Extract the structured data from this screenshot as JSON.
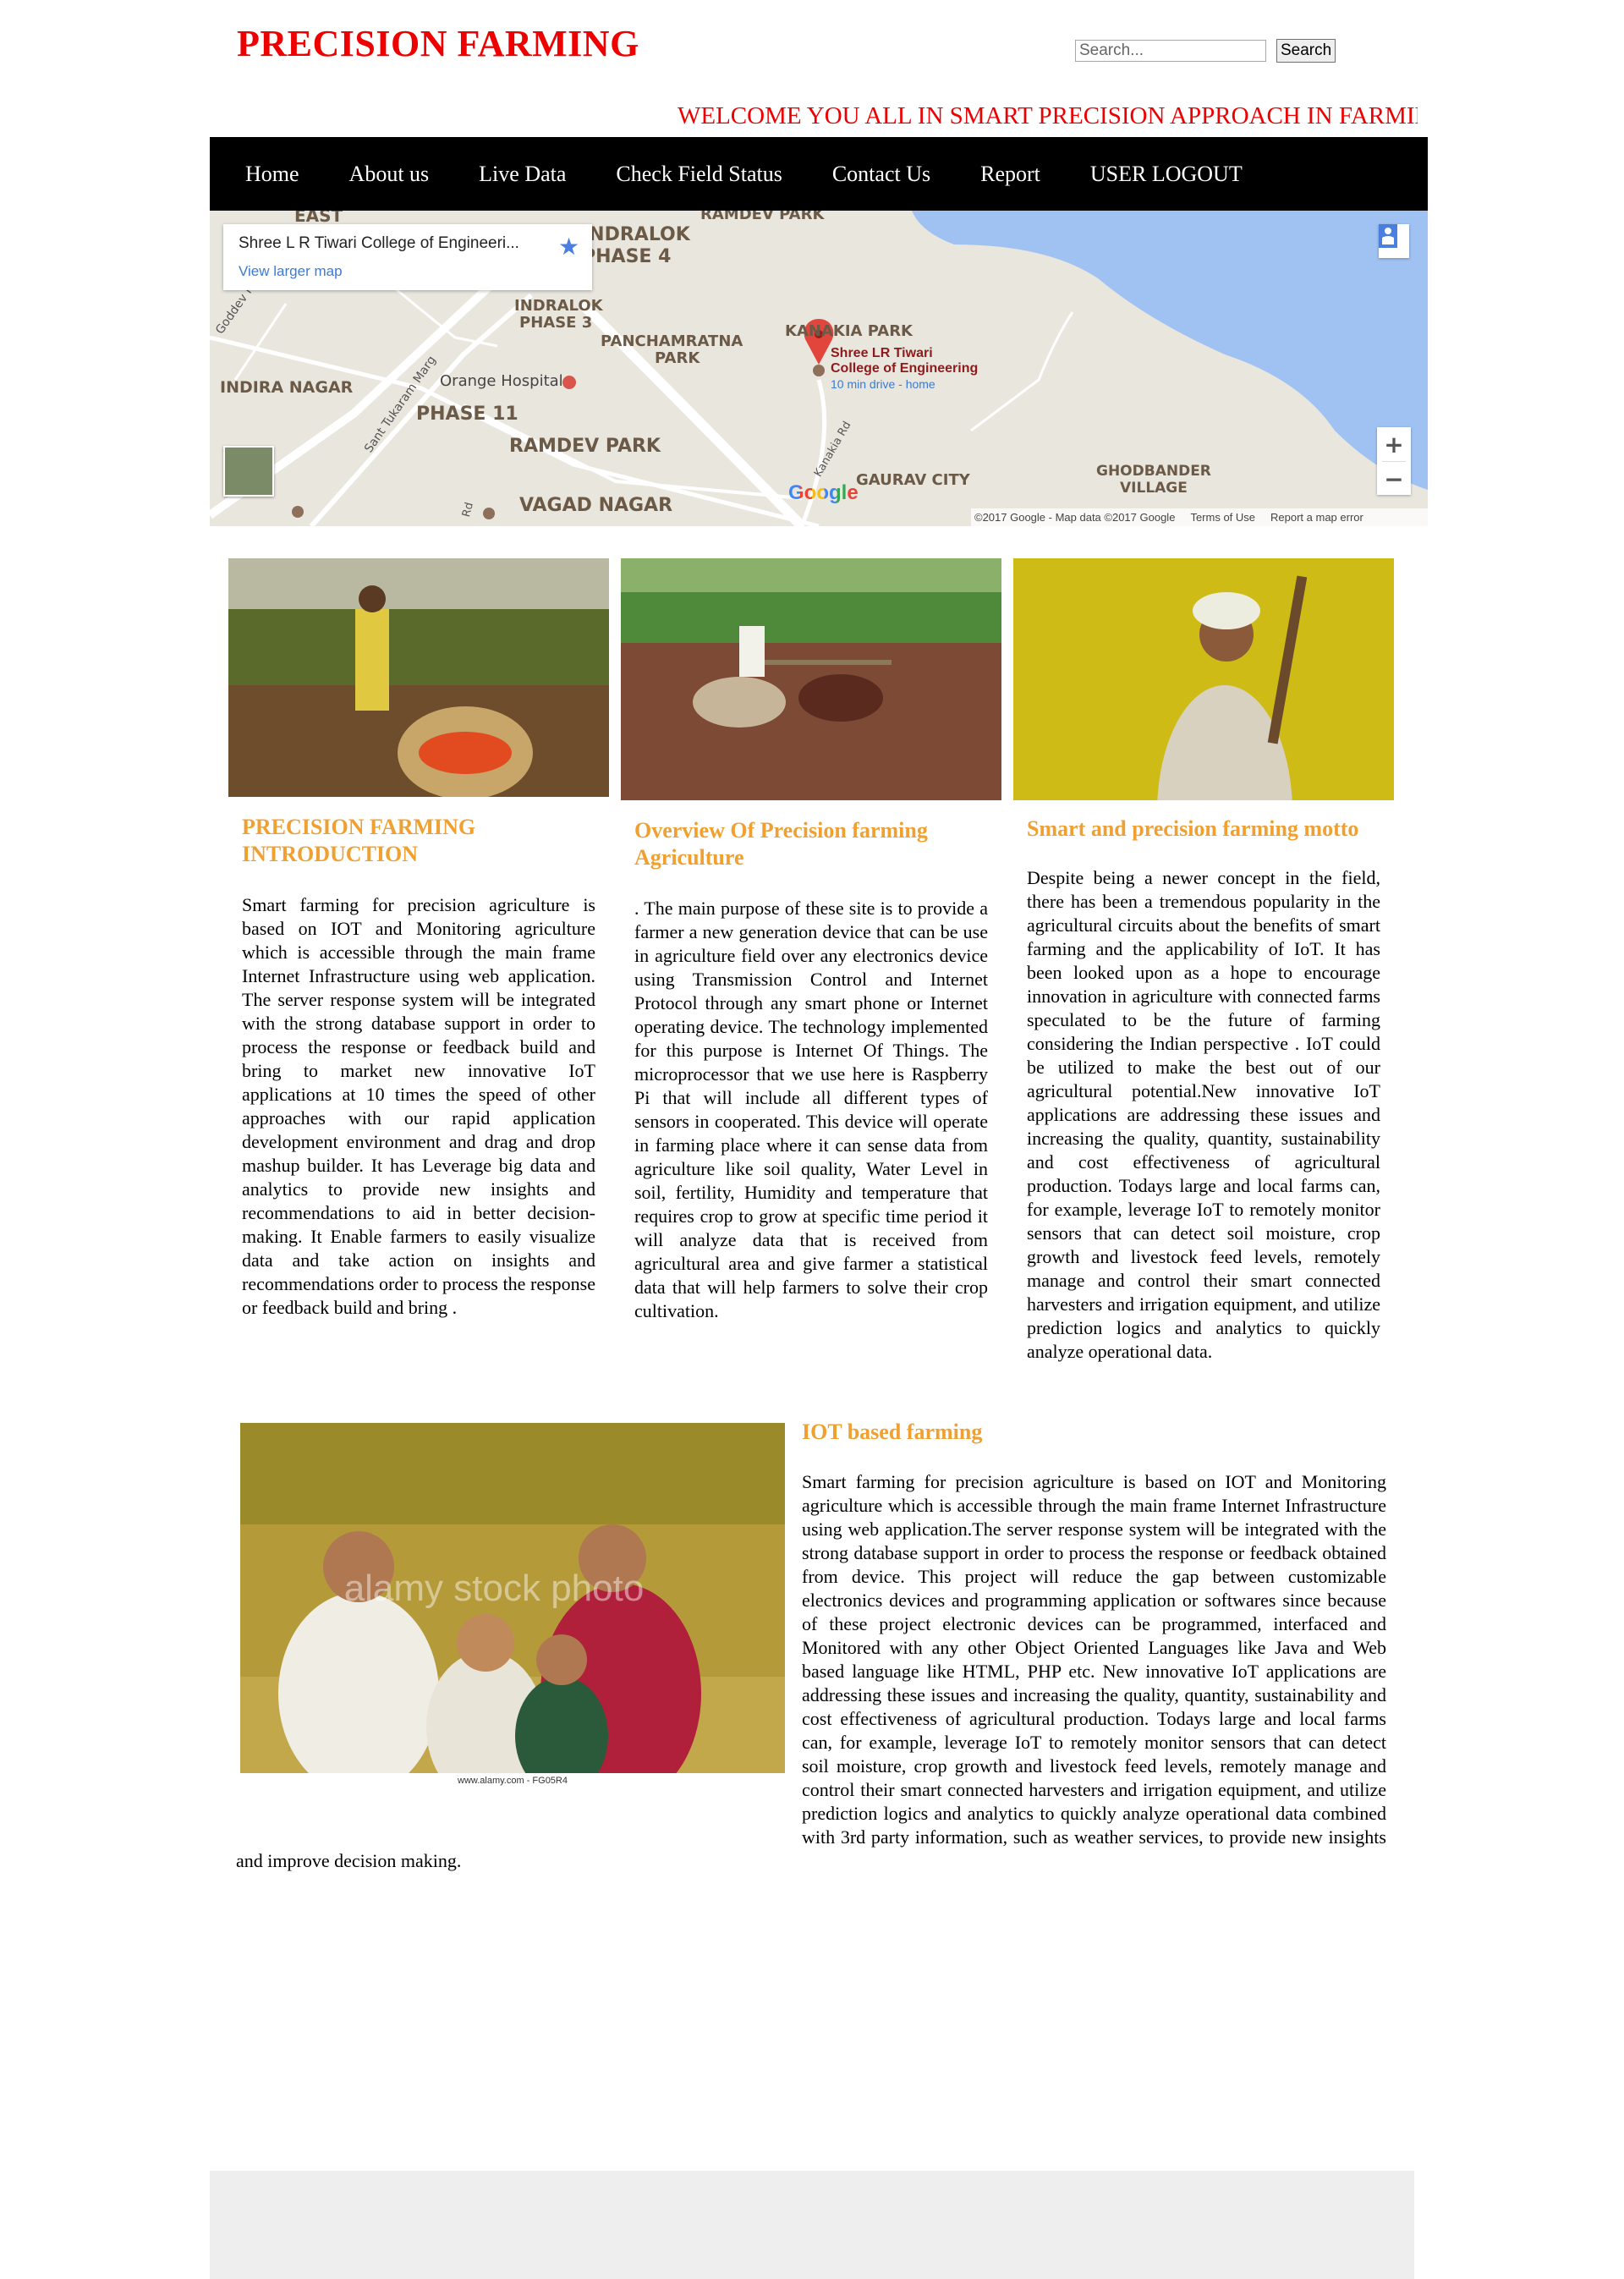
{
  "header": {
    "site_title": "PRECISION FARMING",
    "search_placeholder": "Search...",
    "search_button": "Search",
    "marquee": "WELCOME YOU ALL IN SMART PRECISION APPROACH IN FARMING"
  },
  "nav": {
    "items": [
      "Home",
      "About us",
      "Live Data",
      "Check Field Status",
      "Contact Us",
      "Report",
      "USER LOGOUT"
    ]
  },
  "map": {
    "card_title": "Shree L R Tiwari College of Engineeri...",
    "card_link": "View larger map",
    "marker_title_1": "Shree LR Tiwari",
    "marker_title_2": "College of Engineering",
    "marker_sub": "10 min drive - home",
    "labels": {
      "east": "EAST",
      "ramdev_top": "RAMDEV PARK",
      "indralok4_a": "INDRALOK",
      "indralok4_b": "PHASE 4",
      "indralok3_a": "INDRALOK",
      "indralok3_b": "PHASE 3",
      "panch_a": "PANCHAMRATNA",
      "panch_b": "PARK",
      "kanakia": "KANAKIA PARK",
      "indira": "INDIRA NAGAR",
      "goddev": "Goddev Phatak",
      "tukaram": "Sant Tukaram Marg",
      "orange": "Orange Hospital",
      "phase11": "PHASE 11",
      "ramdev": "RAMDEV PARK",
      "vagad": "VAGAD NAGAR",
      "gaurav": "GAURAV CITY",
      "ghod_a": "GHODBANDER",
      "ghod_b": "VILLAGE",
      "kanakia_rd": "Kanakia Rd",
      "rd": "Rd"
    },
    "google": "Google",
    "attribution": "©2017 Google - Map data ©2017 Google",
    "terms": "Terms of Use",
    "report_error": "Report a map error",
    "zoom_in": "+",
    "zoom_out": "−"
  },
  "columns": [
    {
      "heading": "PRECISION FARMING INTRODUCTION",
      "body": "Smart farming for precision agriculture is based on IOT and Monitoring agriculture which is accessible through the main frame Internet Infrastructure using web application. The server response system will be integrated with the strong database support in order to process the response or feedback build and bring to market new innovative IoT applications at 10 times the speed of other approaches with our rapid application development environment and drag and drop mashup builder. It has Leverage big data and analytics to provide new insights and recommendations to aid in better decision-making. It Enable farmers to easily visualize data and take action on insights and recommendations order to process the response or feedback build and bring ."
    },
    {
      "heading": "Overview Of Precision farming Agriculture",
      "body": ". The main purpose of these site is to provide a farmer a new generation device that can be use in agriculture field over any electronics device using Transmission Control and Internet Protocol through any smart phone or Internet operating device. The technology implemented for this purpose is Internet Of Things. The microprocessor that we use here is Raspberry Pi that will include all different types of sensors in cooperated. This device will operate in farming place where it can sense data from agriculture like soil quality, Water Level in soil, fertility, Humidity and temperature that requires crop to grow at specific time period it will analyze data that is received from agricultural area and give farmer a statistical data that will help farmers to solve their crop cultivation."
    },
    {
      "heading": "Smart and precision farming motto",
      "body": "Despite being a newer concept in the field, there has been a tremendous popularity in the agricultural circuits about the benefits of smart farming and the applicability of IoT. It has been looked upon as a hope to encourage innovation in agriculture with connected farms speculated to be the future of farming considering the Indian perspective . IoT could be utilized to make the best out of our agricultural potential.New innovative IoT applications are addressing these issues and increasing the quality, quantity, sustainability and cost effectiveness of agricultural production. Todays large and local farms can, for example, leverage IoT to remotely monitor sensors that can detect soil moisture, crop growth and livestock feed levels, remotely manage and control their smart connected harvesters and irrigation equipment, and utilize prediction logics and analytics to quickly analyze operational data."
    }
  ],
  "iot": {
    "heading": "IOT based farming",
    "watermark": "alamy stock photo",
    "credit": "www.alamy.com - FG05R4",
    "body": "Smart farming for precision agriculture is based on IOT and Monitoring agriculture which is accessible through the main frame Internet Infrastructure using web application.The server response system will be integrated with the strong database support in order to process the response or feedback obtained from device. This project will reduce the gap between customizable electronics devices and programming application or softwares since because of these project electronic devices can be programmed, interfaced and Monitored with any other Object Oriented Languages like Java and Web based language like HTML, PHP etc. New innovative IoT applications are addressing these issues and increasing the quality, quantity, sustainability and cost effectiveness of agricultural production. Todays large and local farms can, for example, leverage IoT to remotely monitor sensors that can detect soil moisture, crop growth and livestock feed levels, remotely manage and control their smart connected harvesters and irrigation equipment, and utilize prediction logics and analytics to quickly analyze operational data combined with 3rd party information, such as weather services, to provide new insights and improve decision making."
  },
  "colors": {
    "title_red": "#ee0000",
    "heading_orange": "#f0a030",
    "nav_bg": "#000000",
    "water_blue": "#9fc2f2",
    "marker_red": "#e2453c",
    "footer_gray": "#eeeeee"
  }
}
